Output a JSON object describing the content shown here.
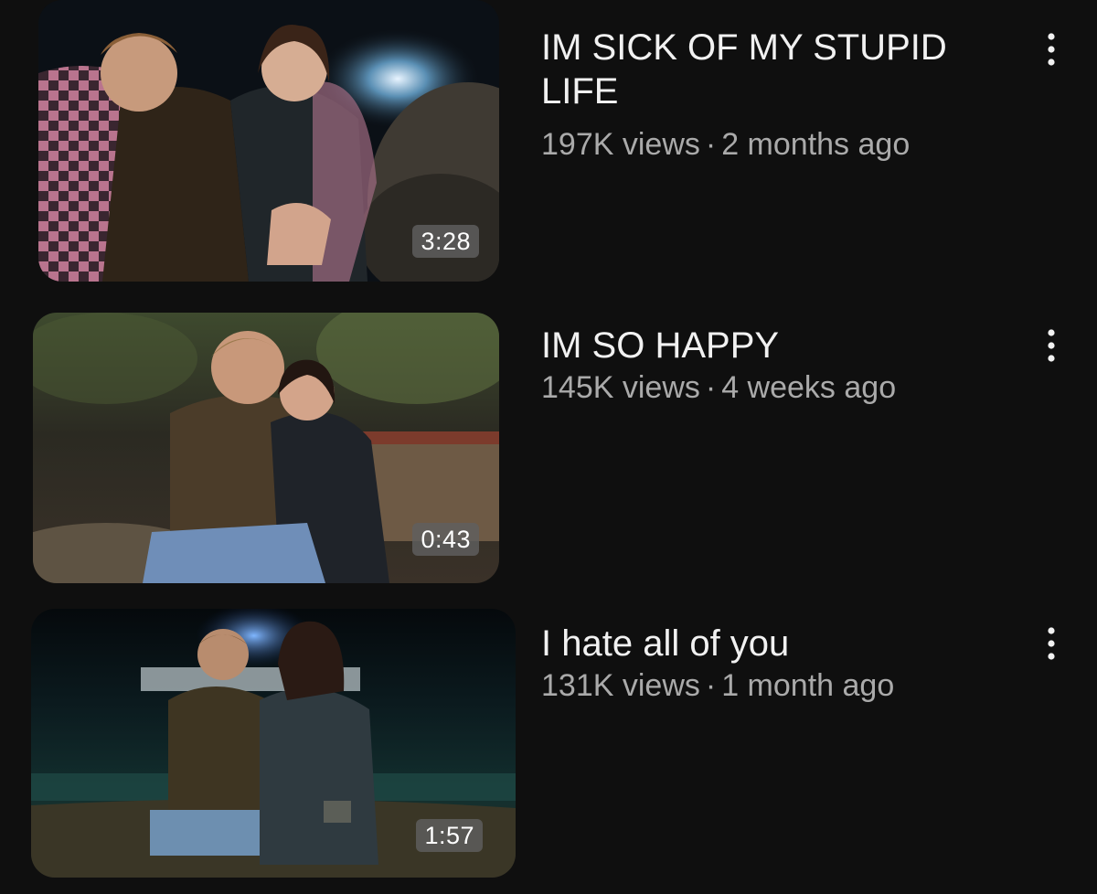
{
  "videos": [
    {
      "title": "IM SICK OF MY STUPID LIFE",
      "views": "197K views",
      "separator": "·",
      "age": "2 months ago",
      "duration": "3:28",
      "thumbnail_icon": "video-thumbnail-couple-blanket-night"
    },
    {
      "title": "IM SO HAPPY",
      "views": "145K views",
      "separator": "·",
      "age": "4 weeks ago",
      "duration": "0:43",
      "thumbnail_icon": "video-thumbnail-couple-hugging"
    },
    {
      "title": "I hate all of you",
      "views": "131K views",
      "separator": "·",
      "age": "1 month ago",
      "duration": "1:57",
      "thumbnail_icon": "video-thumbnail-kneeling-man-night-sea"
    }
  ],
  "more_icon": "more-vertical-icon",
  "colors": {
    "background": "#0f0f0f",
    "title": "#f1f1f1",
    "meta": "#aaaaaa",
    "duration_badge": "#5f5f5f"
  }
}
